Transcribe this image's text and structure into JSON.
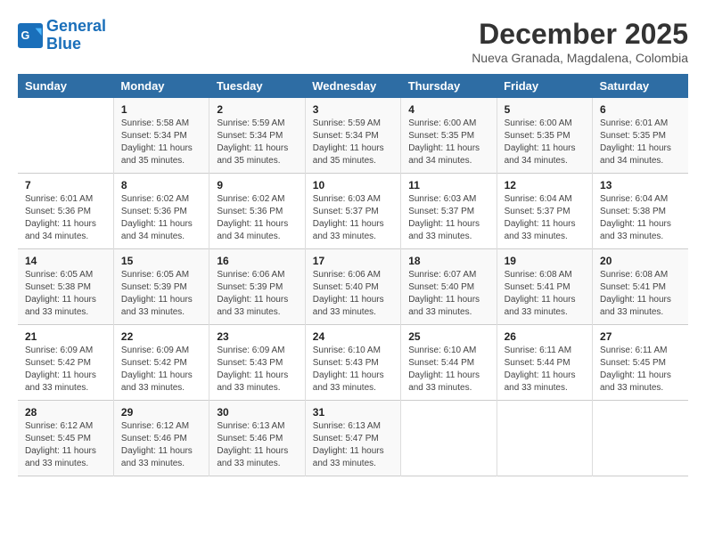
{
  "logo": {
    "line1": "General",
    "line2": "Blue"
  },
  "header": {
    "month": "December 2025",
    "location": "Nueva Granada, Magdalena, Colombia"
  },
  "weekdays": [
    "Sunday",
    "Monday",
    "Tuesday",
    "Wednesday",
    "Thursday",
    "Friday",
    "Saturday"
  ],
  "weeks": [
    [
      {
        "day": "",
        "sunrise": "",
        "sunset": "",
        "daylight": ""
      },
      {
        "day": "1",
        "sunrise": "Sunrise: 5:58 AM",
        "sunset": "Sunset: 5:34 PM",
        "daylight": "Daylight: 11 hours and 35 minutes."
      },
      {
        "day": "2",
        "sunrise": "Sunrise: 5:59 AM",
        "sunset": "Sunset: 5:34 PM",
        "daylight": "Daylight: 11 hours and 35 minutes."
      },
      {
        "day": "3",
        "sunrise": "Sunrise: 5:59 AM",
        "sunset": "Sunset: 5:34 PM",
        "daylight": "Daylight: 11 hours and 35 minutes."
      },
      {
        "day": "4",
        "sunrise": "Sunrise: 6:00 AM",
        "sunset": "Sunset: 5:35 PM",
        "daylight": "Daylight: 11 hours and 34 minutes."
      },
      {
        "day": "5",
        "sunrise": "Sunrise: 6:00 AM",
        "sunset": "Sunset: 5:35 PM",
        "daylight": "Daylight: 11 hours and 34 minutes."
      },
      {
        "day": "6",
        "sunrise": "Sunrise: 6:01 AM",
        "sunset": "Sunset: 5:35 PM",
        "daylight": "Daylight: 11 hours and 34 minutes."
      }
    ],
    [
      {
        "day": "7",
        "sunrise": "Sunrise: 6:01 AM",
        "sunset": "Sunset: 5:36 PM",
        "daylight": "Daylight: 11 hours and 34 minutes."
      },
      {
        "day": "8",
        "sunrise": "Sunrise: 6:02 AM",
        "sunset": "Sunset: 5:36 PM",
        "daylight": "Daylight: 11 hours and 34 minutes."
      },
      {
        "day": "9",
        "sunrise": "Sunrise: 6:02 AM",
        "sunset": "Sunset: 5:36 PM",
        "daylight": "Daylight: 11 hours and 34 minutes."
      },
      {
        "day": "10",
        "sunrise": "Sunrise: 6:03 AM",
        "sunset": "Sunset: 5:37 PM",
        "daylight": "Daylight: 11 hours and 33 minutes."
      },
      {
        "day": "11",
        "sunrise": "Sunrise: 6:03 AM",
        "sunset": "Sunset: 5:37 PM",
        "daylight": "Daylight: 11 hours and 33 minutes."
      },
      {
        "day": "12",
        "sunrise": "Sunrise: 6:04 AM",
        "sunset": "Sunset: 5:37 PM",
        "daylight": "Daylight: 11 hours and 33 minutes."
      },
      {
        "day": "13",
        "sunrise": "Sunrise: 6:04 AM",
        "sunset": "Sunset: 5:38 PM",
        "daylight": "Daylight: 11 hours and 33 minutes."
      }
    ],
    [
      {
        "day": "14",
        "sunrise": "Sunrise: 6:05 AM",
        "sunset": "Sunset: 5:38 PM",
        "daylight": "Daylight: 11 hours and 33 minutes."
      },
      {
        "day": "15",
        "sunrise": "Sunrise: 6:05 AM",
        "sunset": "Sunset: 5:39 PM",
        "daylight": "Daylight: 11 hours and 33 minutes."
      },
      {
        "day": "16",
        "sunrise": "Sunrise: 6:06 AM",
        "sunset": "Sunset: 5:39 PM",
        "daylight": "Daylight: 11 hours and 33 minutes."
      },
      {
        "day": "17",
        "sunrise": "Sunrise: 6:06 AM",
        "sunset": "Sunset: 5:40 PM",
        "daylight": "Daylight: 11 hours and 33 minutes."
      },
      {
        "day": "18",
        "sunrise": "Sunrise: 6:07 AM",
        "sunset": "Sunset: 5:40 PM",
        "daylight": "Daylight: 11 hours and 33 minutes."
      },
      {
        "day": "19",
        "sunrise": "Sunrise: 6:08 AM",
        "sunset": "Sunset: 5:41 PM",
        "daylight": "Daylight: 11 hours and 33 minutes."
      },
      {
        "day": "20",
        "sunrise": "Sunrise: 6:08 AM",
        "sunset": "Sunset: 5:41 PM",
        "daylight": "Daylight: 11 hours and 33 minutes."
      }
    ],
    [
      {
        "day": "21",
        "sunrise": "Sunrise: 6:09 AM",
        "sunset": "Sunset: 5:42 PM",
        "daylight": "Daylight: 11 hours and 33 minutes."
      },
      {
        "day": "22",
        "sunrise": "Sunrise: 6:09 AM",
        "sunset": "Sunset: 5:42 PM",
        "daylight": "Daylight: 11 hours and 33 minutes."
      },
      {
        "day": "23",
        "sunrise": "Sunrise: 6:09 AM",
        "sunset": "Sunset: 5:43 PM",
        "daylight": "Daylight: 11 hours and 33 minutes."
      },
      {
        "day": "24",
        "sunrise": "Sunrise: 6:10 AM",
        "sunset": "Sunset: 5:43 PM",
        "daylight": "Daylight: 11 hours and 33 minutes."
      },
      {
        "day": "25",
        "sunrise": "Sunrise: 6:10 AM",
        "sunset": "Sunset: 5:44 PM",
        "daylight": "Daylight: 11 hours and 33 minutes."
      },
      {
        "day": "26",
        "sunrise": "Sunrise: 6:11 AM",
        "sunset": "Sunset: 5:44 PM",
        "daylight": "Daylight: 11 hours and 33 minutes."
      },
      {
        "day": "27",
        "sunrise": "Sunrise: 6:11 AM",
        "sunset": "Sunset: 5:45 PM",
        "daylight": "Daylight: 11 hours and 33 minutes."
      }
    ],
    [
      {
        "day": "28",
        "sunrise": "Sunrise: 6:12 AM",
        "sunset": "Sunset: 5:45 PM",
        "daylight": "Daylight: 11 hours and 33 minutes."
      },
      {
        "day": "29",
        "sunrise": "Sunrise: 6:12 AM",
        "sunset": "Sunset: 5:46 PM",
        "daylight": "Daylight: 11 hours and 33 minutes."
      },
      {
        "day": "30",
        "sunrise": "Sunrise: 6:13 AM",
        "sunset": "Sunset: 5:46 PM",
        "daylight": "Daylight: 11 hours and 33 minutes."
      },
      {
        "day": "31",
        "sunrise": "Sunrise: 6:13 AM",
        "sunset": "Sunset: 5:47 PM",
        "daylight": "Daylight: 11 hours and 33 minutes."
      },
      {
        "day": "",
        "sunrise": "",
        "sunset": "",
        "daylight": ""
      },
      {
        "day": "",
        "sunrise": "",
        "sunset": "",
        "daylight": ""
      },
      {
        "day": "",
        "sunrise": "",
        "sunset": "",
        "daylight": ""
      }
    ]
  ]
}
